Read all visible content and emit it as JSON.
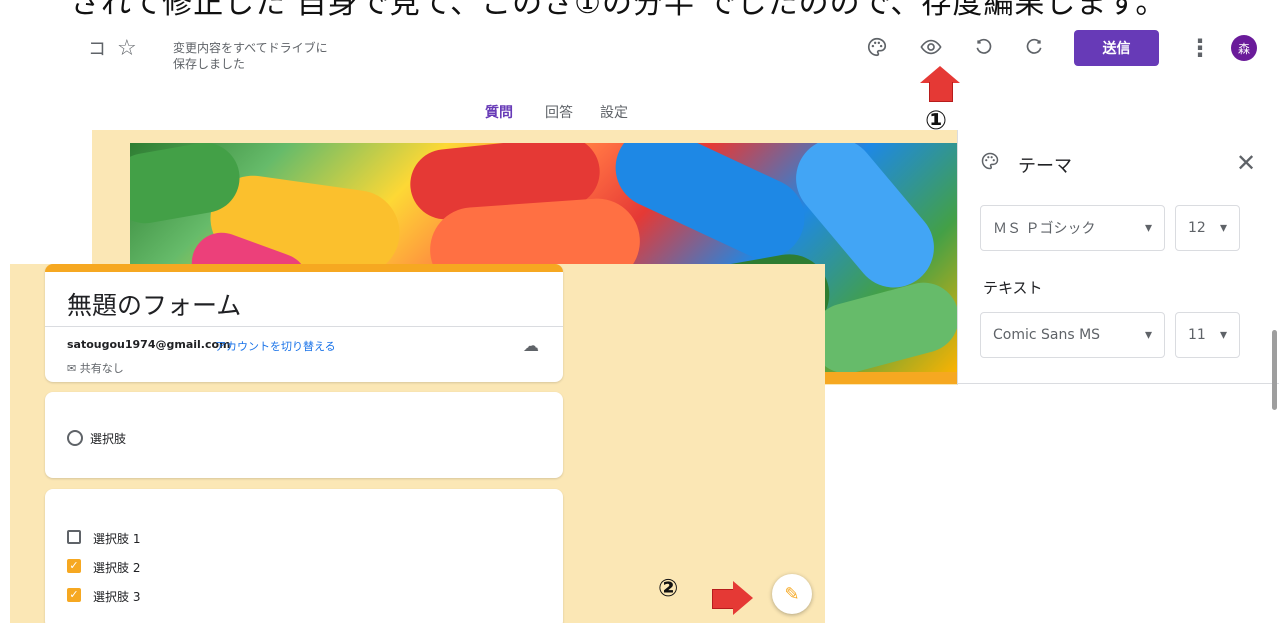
{
  "instruction": "されて修正した 自身で見て、このさ①の分半 でしたのので、存度編果します。",
  "topbar": {
    "folder_icon": "folder-icon",
    "star_icon": "☆",
    "save_status_line1": "変更内容をすべてドライブに",
    "save_status_line2": "保存しました",
    "palette_icon": "palette-icon",
    "preview_icon": "eye-icon",
    "undo_icon": "undo-icon",
    "redo_icon": "redo-icon",
    "send_label": "送信",
    "more_icon": "⋮",
    "avatar_initial": "森"
  },
  "tabs": [
    "質問",
    "回答",
    "設定"
  ],
  "markers": {
    "one": "①",
    "two": "②"
  },
  "theme_panel": {
    "title": "テーマ",
    "header_font": "ＭＳ Ｐゴシック",
    "header_size": "12",
    "text_label": "テキスト",
    "text_font": "Comic Sans MS",
    "text_size": "11"
  },
  "preview": {
    "form_title": "無題のフォーム",
    "account_email": "satougou1974@gmail.com",
    "switch_account": "アカウントを切り替える",
    "not_shared": "共有なし",
    "radio_option": "選択肢",
    "checkbox_options": [
      {
        "label": "選択肢 1",
        "checked": false
      },
      {
        "label": "選択肢 2",
        "checked": true
      },
      {
        "label": "選択肢 3",
        "checked": true
      }
    ]
  },
  "colors": {
    "accent": "#673ab7",
    "theme": "#f6a821",
    "background": "#fbe7b5",
    "arrow": "#e53935"
  }
}
